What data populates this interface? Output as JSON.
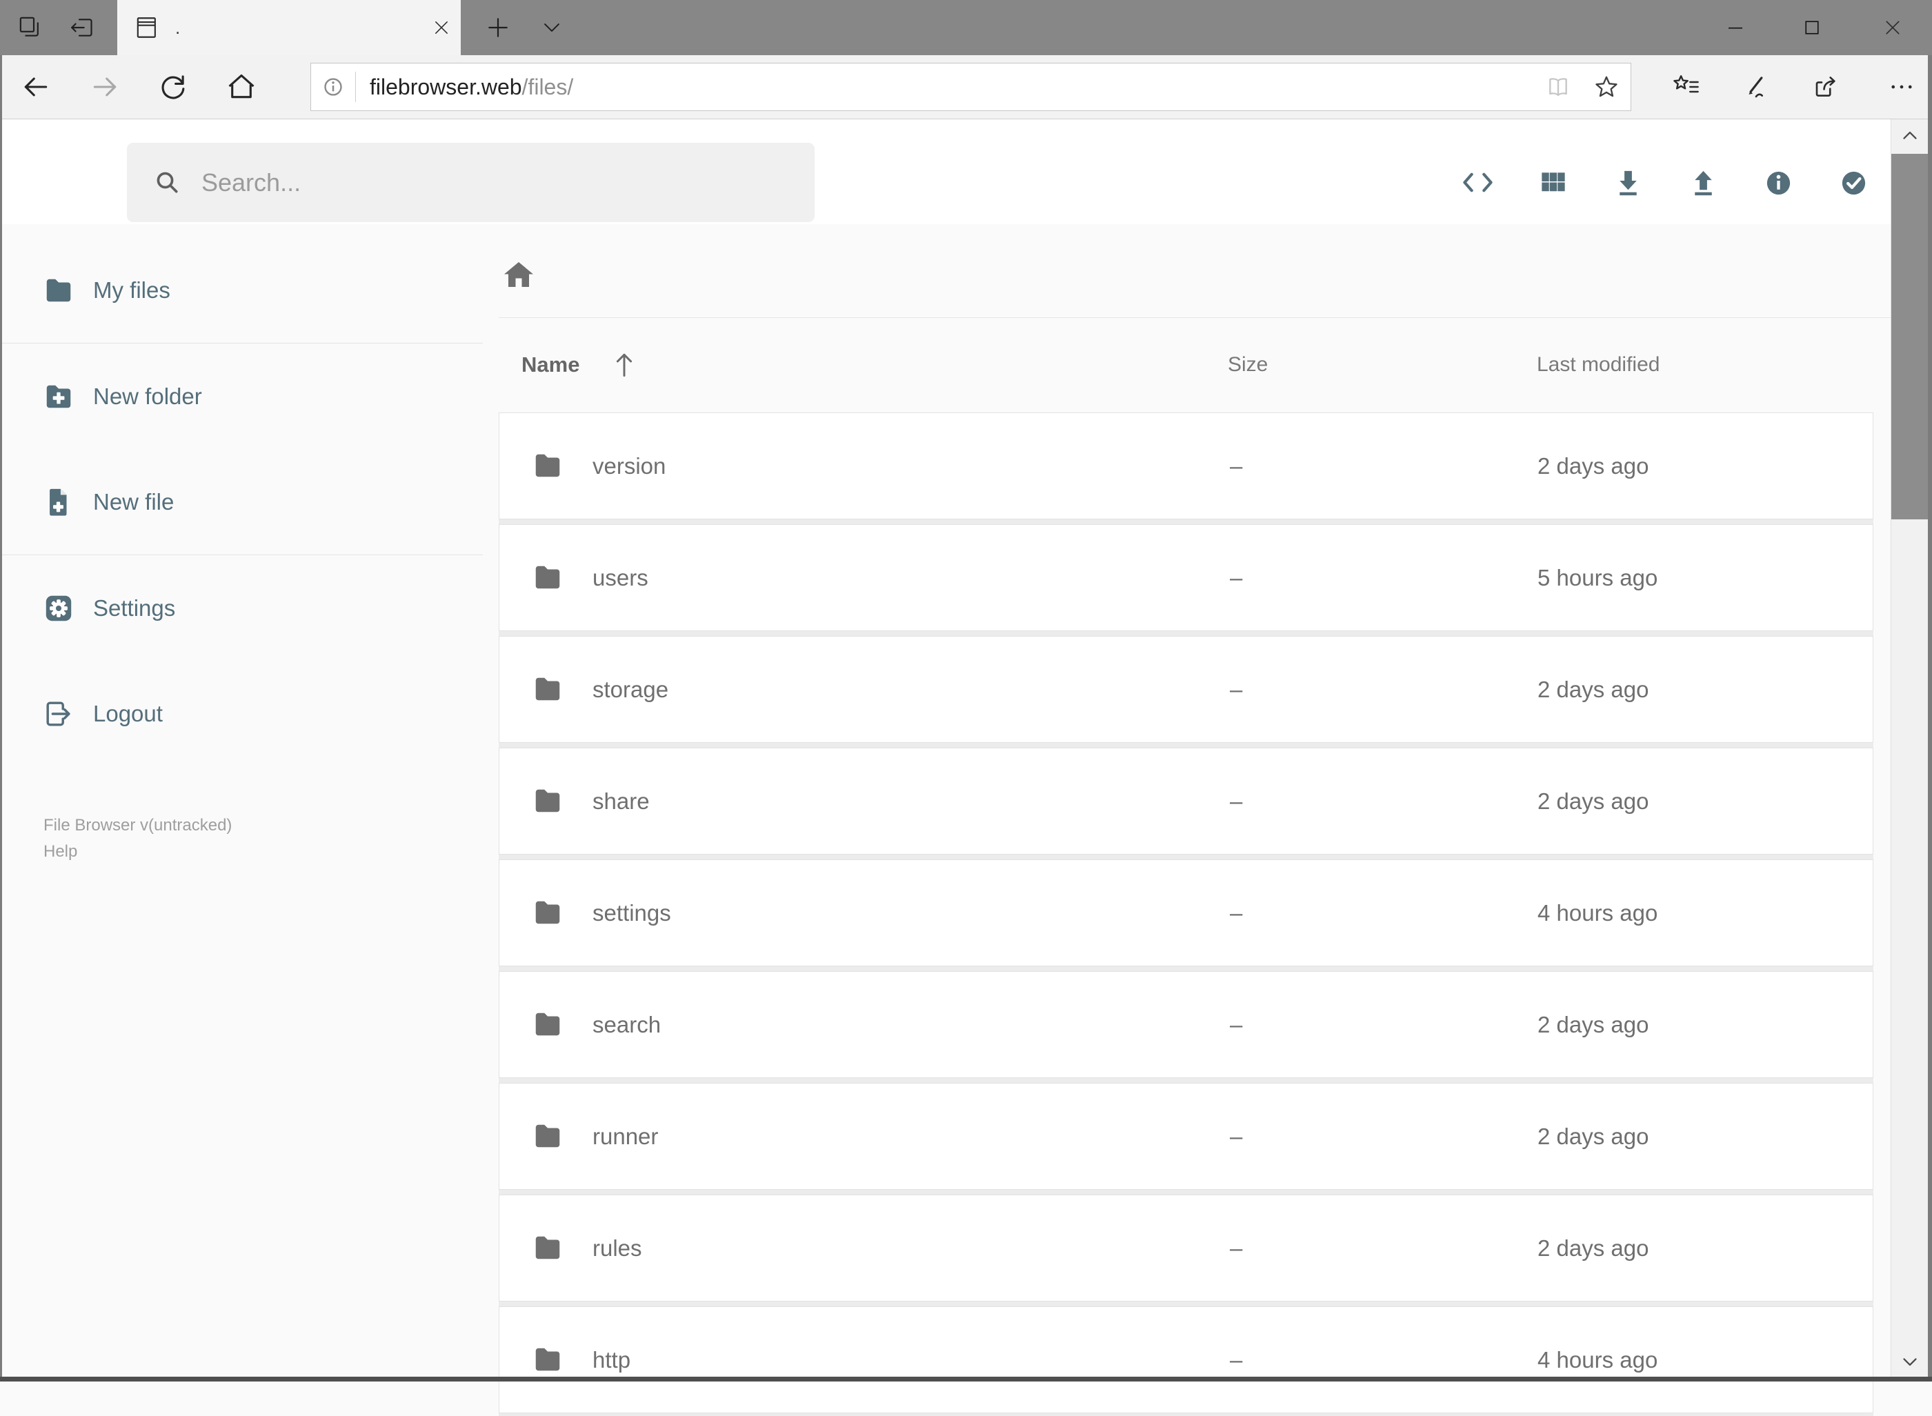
{
  "browser": {
    "tab_title": ".",
    "url": {
      "host": "filebrowser.web",
      "path": "/files/"
    }
  },
  "app": {
    "colors": {
      "accent": "#546e7a",
      "logo_ring": "#1f63e6",
      "logo_disk": "#33b6f2"
    },
    "search": {
      "placeholder": "Search..."
    },
    "toolbar": {
      "buttons": [
        {
          "sym": "code",
          "name": "code-view-button"
        },
        {
          "sym": "grid",
          "name": "grid-view-button"
        },
        {
          "sym": "download",
          "name": "download-button"
        },
        {
          "sym": "upload",
          "name": "upload-button"
        },
        {
          "sym": "info",
          "name": "info-button"
        },
        {
          "sym": "check",
          "name": "select-multiple-button"
        }
      ]
    },
    "sidebar": {
      "groups": [
        {
          "items": [
            {
              "icon": "folder",
              "label": "My files"
            }
          ]
        },
        {
          "items": [
            {
              "icon": "folder-plus",
              "label": "New folder"
            },
            {
              "icon": "file-plus",
              "label": "New file"
            }
          ]
        },
        {
          "items": [
            {
              "icon": "gear",
              "label": "Settings"
            },
            {
              "icon": "logout",
              "label": "Logout"
            }
          ]
        }
      ],
      "footer": {
        "version": "File Browser v(untracked)",
        "help": "Help"
      }
    },
    "listing": {
      "columns": [
        {
          "label": "Name",
          "sorted": "ascending"
        },
        {
          "label": "Size"
        },
        {
          "label": "Last modified"
        }
      ],
      "rows": [
        {
          "icon": "folder",
          "name": "version",
          "size": "–",
          "modified": "2 days ago"
        },
        {
          "icon": "folder",
          "name": "users",
          "size": "–",
          "modified": "5 hours ago"
        },
        {
          "icon": "folder",
          "name": "storage",
          "size": "–",
          "modified": "2 days ago"
        },
        {
          "icon": "folder",
          "name": "share",
          "size": "–",
          "modified": "2 days ago"
        },
        {
          "icon": "folder",
          "name": "settings",
          "size": "–",
          "modified": "4 hours ago"
        },
        {
          "icon": "folder",
          "name": "search",
          "size": "–",
          "modified": "2 days ago"
        },
        {
          "icon": "folder",
          "name": "runner",
          "size": "–",
          "modified": "2 days ago"
        },
        {
          "icon": "folder",
          "name": "rules",
          "size": "–",
          "modified": "2 days ago"
        },
        {
          "icon": "folder",
          "name": "http",
          "size": "–",
          "modified": "4 hours ago"
        }
      ]
    }
  }
}
